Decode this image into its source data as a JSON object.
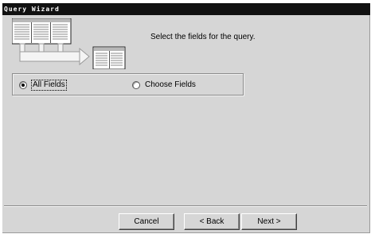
{
  "window": {
    "title": "Query Wizard"
  },
  "header": {
    "instruction": "Select the fields for the query."
  },
  "options": {
    "all_fields": {
      "label": "All Fields",
      "selected": true
    },
    "choose_fields": {
      "label": "Choose Fields",
      "selected": false
    }
  },
  "buttons": {
    "cancel": "Cancel",
    "back": "< Back",
    "next": "Next >"
  }
}
